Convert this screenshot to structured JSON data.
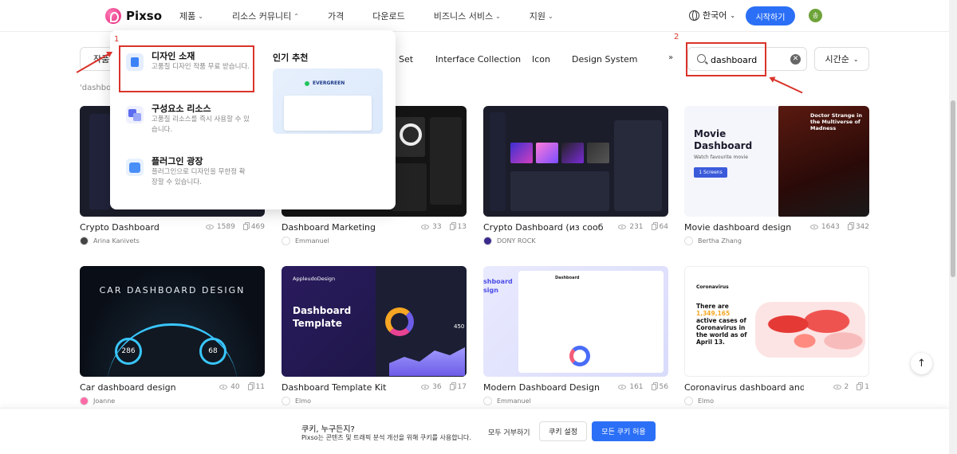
{
  "header": {
    "logo_text": "Pixso",
    "nav": [
      {
        "label": "제품",
        "chevron": "⌄"
      },
      {
        "label": "리소스 커뮤니티",
        "chevron": "⌃"
      },
      {
        "label": "가격",
        "chevron": ""
      },
      {
        "label": "다운로드",
        "chevron": ""
      },
      {
        "label": "비즈니스 서비스",
        "chevron": "⌄"
      },
      {
        "label": "지원",
        "chevron": "⌄"
      }
    ],
    "language": "한국어",
    "start_button": "시작하기",
    "avatar_initial": "송"
  },
  "filters": {
    "active_tab": "작품",
    "tabs": [
      "Set",
      "Interface Collection",
      "Icon",
      "Design System"
    ],
    "more": "»",
    "search_value": "dashboard",
    "sort_label": "시간순",
    "result_prefix": "'dashbo"
  },
  "annotations": {
    "one": "1",
    "two": "2"
  },
  "dropdown": {
    "items": [
      {
        "title": "디자인 소재",
        "desc": "고품질 디자인 작품 무료 받습니다."
      },
      {
        "title": "구성요소 리소스",
        "desc": "고품질 리소스를 즉시 사용할 수 있습니다."
      },
      {
        "title": "플러그인 광장",
        "desc": "플러그인으로 디자인을 무한정 확장할 수 있습니다."
      }
    ],
    "popular_label": "인기 추천",
    "popular_card_text": "EVERGREEN"
  },
  "cards": [
    {
      "title": "Crypto Dashboard",
      "views": "1589",
      "copies": "469",
      "author": "Arina Kanivets"
    },
    {
      "title": "Dashboard Marketing",
      "views": "33",
      "copies": "13",
      "author": "Emmanuel"
    },
    {
      "title": "Crypto Dashboard (из сооб…",
      "views": "231",
      "copies": "64",
      "author": "DONY ROCK"
    },
    {
      "title": "Movie dashboard design",
      "views": "1643",
      "copies": "342",
      "author": "Bertha Zhang"
    },
    {
      "title": "Car dashboard design",
      "views": "40",
      "copies": "11",
      "author": "Joanne"
    },
    {
      "title": "Dashboard Template Kit",
      "views": "36",
      "copies": "17",
      "author": "Elmo"
    },
    {
      "title": "Modern Dashboard Design",
      "views": "161",
      "copies": "56",
      "author": "Emmanuel"
    },
    {
      "title": "Coronavirus dashboard and…",
      "views": "2",
      "copies": "1",
      "author": "Elmo"
    }
  ],
  "thumbs": {
    "movie_title": "Movie Dashboard",
    "movie_sub": "Watch favourite movie",
    "movie_btn": "1 Screens",
    "movie_banner": "Doctor Strange in the Multiverse of Madness",
    "car_title": "CAR DASHBOARD DESIGN",
    "car_speed_left": "286",
    "car_speed_right": "68",
    "kit_brand": "AppleudoDesign",
    "kit_title": "Dashboard Template",
    "kit_stat": "450",
    "modern_title": "shboard sign",
    "modern_header": "Dashboard",
    "corona_brand": "Coronavirus",
    "corona_text_1": "There are",
    "corona_number": "1,349,165",
    "corona_text_2": "active cases of Coronavirus in the world as of April 13."
  },
  "cookie": {
    "title": "쿠키, 누구든지?",
    "desc": "Pixso는 콘텐츠 및 트래픽 분석 개선을 위해 쿠키를 사용합니다.",
    "reject": "모두 거부하기",
    "settings": "쿠키 설정",
    "accept": "모든 쿠키 허용"
  },
  "colors": {
    "accent": "#2b6ff6",
    "annotation": "#d9342b",
    "brand_pink": "#e3257a"
  }
}
